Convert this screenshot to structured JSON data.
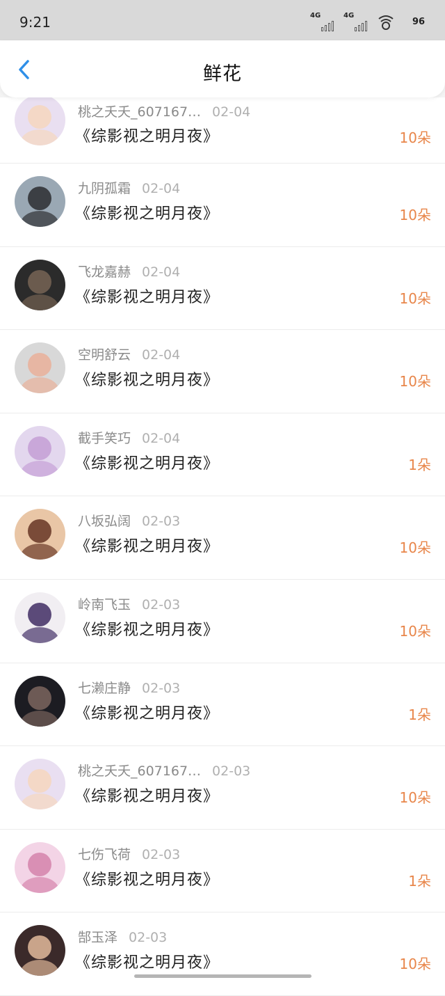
{
  "status": {
    "time": "9:21",
    "signal1_label": "4G",
    "signal2_label": "4G",
    "battery": "96"
  },
  "header": {
    "title": "鲜花"
  },
  "colors": {
    "accent": "#2f8fe8",
    "quantity": "#e8864a"
  },
  "entries": [
    {
      "user": "桃之夭夭_607167…",
      "date": "02-04",
      "book": "《综影视之明月夜》",
      "qty": "10朵",
      "avatar_bg": "#e9dff1",
      "avatar_fg": "#f4d8c6"
    },
    {
      "user": "九阴孤霜",
      "date": "02-04",
      "book": "《综影视之明月夜》",
      "qty": "10朵",
      "avatar_bg": "#9aa8b4",
      "avatar_fg": "#3c3f44"
    },
    {
      "user": "飞龙嘉赫",
      "date": "02-04",
      "book": "《综影视之明月夜》",
      "qty": "10朵",
      "avatar_bg": "#2b2b2b",
      "avatar_fg": "#6b5b4e"
    },
    {
      "user": "空明舒云",
      "date": "02-04",
      "book": "《综影视之明月夜》",
      "qty": "10朵",
      "avatar_bg": "#d8d8d8",
      "avatar_fg": "#e7b6a3"
    },
    {
      "user": "截手笑巧",
      "date": "02-04",
      "book": "《综影视之明月夜》",
      "qty": "1朵",
      "avatar_bg": "#e3d7ee",
      "avatar_fg": "#c9a7d9"
    },
    {
      "user": "八坂弘阔",
      "date": "02-03",
      "book": "《综影视之明月夜》",
      "qty": "10朵",
      "avatar_bg": "#e9c6a6",
      "avatar_fg": "#7a4b38"
    },
    {
      "user": "岭南飞玉",
      "date": "02-03",
      "book": "《综影视之明月夜》",
      "qty": "10朵",
      "avatar_bg": "#f1eef2",
      "avatar_fg": "#5b4a79"
    },
    {
      "user": "七濑庄静",
      "date": "02-03",
      "book": "《综影视之明月夜》",
      "qty": "1朵",
      "avatar_bg": "#1c1c22",
      "avatar_fg": "#6d5a55"
    },
    {
      "user": "桃之夭夭_607167…",
      "date": "02-03",
      "book": "《综影视之明月夜》",
      "qty": "10朵",
      "avatar_bg": "#e9dff1",
      "avatar_fg": "#f4d8c6"
    },
    {
      "user": "七伤飞荷",
      "date": "02-03",
      "book": "《综影视之明月夜》",
      "qty": "1朵",
      "avatar_bg": "#f3d4e6",
      "avatar_fg": "#d98fb4"
    },
    {
      "user": "郜玉泽",
      "date": "02-03",
      "book": "《综影视之明月夜》",
      "qty": "10朵",
      "avatar_bg": "#3b2a2a",
      "avatar_fg": "#c9a48a"
    }
  ]
}
